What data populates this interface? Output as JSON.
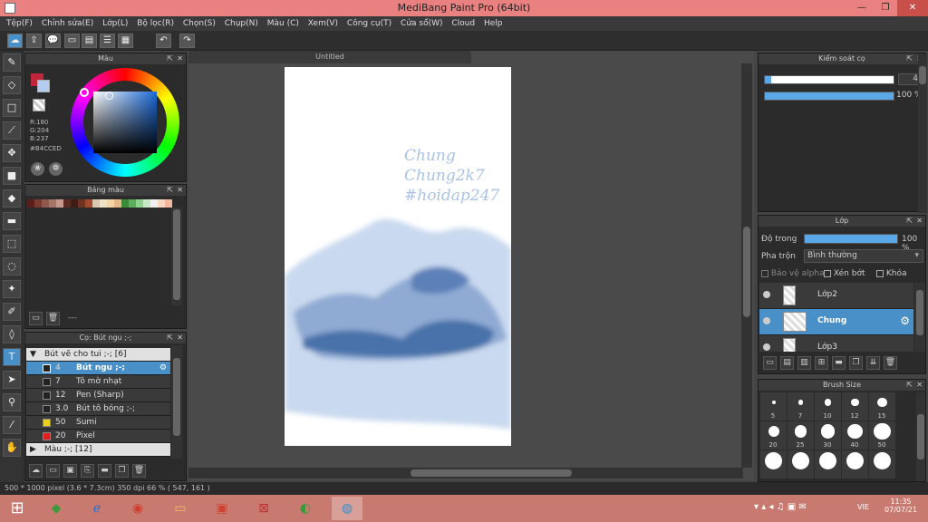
{
  "window": {
    "title": "MediBang Paint Pro (64bit)",
    "min": "—",
    "max": "❐",
    "close": "✕"
  },
  "menu": [
    "Tệp(F)",
    "Chỉnh sửa(E)",
    "Lớp(L)",
    "Bộ lọc(R)",
    "Chọn(S)",
    "Chụp(N)",
    "Màu (C)",
    "Xem(V)",
    "Công cụ(T)",
    "Cửa sổ(W)",
    "Cloud",
    "Help"
  ],
  "color_panel": {
    "title": "Màu",
    "r": "R:180",
    "g": "G:204",
    "b": "B:237",
    "hex": "#B4CCED",
    "primary_color": "#B4CCED",
    "secondary_color": "#c0263a"
  },
  "palette_panel": {
    "title": "Bảng màu",
    "colors": [
      "#5a1f1a",
      "#7a3a30",
      "#8f5a4e",
      "#a8756a",
      "#c49a8e",
      "#5d2a22",
      "#3f1d16",
      "#6d3325",
      "#a24a2e",
      "#d8c8b0",
      "#efe0c8",
      "#f3d6a8",
      "#e8b88a",
      "#3a8a3a",
      "#5cae5c",
      "#8fd28f",
      "#c8e8c8",
      "#f0f0f0",
      "#f8d8c0",
      "#f4b8a0"
    ],
    "footer_label": "---"
  },
  "brush_list_panel": {
    "title": "Cọ: Bút ngu ;-;",
    "group1": "Bút vẽ cho tui ;-; [6]",
    "brushes": [
      {
        "num": "4",
        "label": "Bút ngu ;-;",
        "swatch": "#222222",
        "active": true
      },
      {
        "num": "7",
        "label": "Tô mờ nhạt",
        "swatch": "#222222",
        "active": false
      },
      {
        "num": "12",
        "label": "Pen (Sharp)",
        "swatch": "#222222",
        "active": false
      },
      {
        "num": "3.0",
        "label": "Bút tô bóng ;-;",
        "swatch": "#222222",
        "active": false
      },
      {
        "num": "50",
        "label": "Sumi",
        "swatch": "#e8d020",
        "active": false
      },
      {
        "num": "20",
        "label": "Pixel",
        "swatch": "#e02020",
        "active": false
      }
    ],
    "group2": "Màu ;-; [12]"
  },
  "document": {
    "tab": "Untitled",
    "lines": [
      "Chung",
      "Chung2k7",
      "#hoidap247"
    ]
  },
  "brush_control": {
    "title": "Kiểm soát cọ",
    "size": "4",
    "opacity": "100 %",
    "size_level": 0.05,
    "opacity_level": 1.0
  },
  "layer_panel": {
    "title": "Lớp",
    "opacity_label": "Độ trong",
    "opacity_value": "100 %",
    "blend_label": "Pha trộn",
    "blend_value": "Bình thường",
    "protect_alpha": "Bảo vệ alpha",
    "clipping": "Xén bớt",
    "lock": "Khóa",
    "layers": [
      {
        "name": "Lớp2",
        "active": false
      },
      {
        "name": "Chung",
        "active": true
      },
      {
        "name": "Lớp3",
        "active": false
      }
    ]
  },
  "brush_size_panel": {
    "title": "Brush Size",
    "sizes": [
      "5",
      "7",
      "10",
      "12",
      "15",
      "20",
      "25",
      "30",
      "40",
      "50",
      "",
      "",
      "",
      "",
      ""
    ]
  },
  "status": {
    "text": "500 * 1000 pixel   (3.6 * 7.3cm)   350 dpi   66 %   ( 547, 161 )"
  },
  "taskbar": {
    "lang": "VIE",
    "time": "11:35",
    "date": "07/07/21"
  }
}
